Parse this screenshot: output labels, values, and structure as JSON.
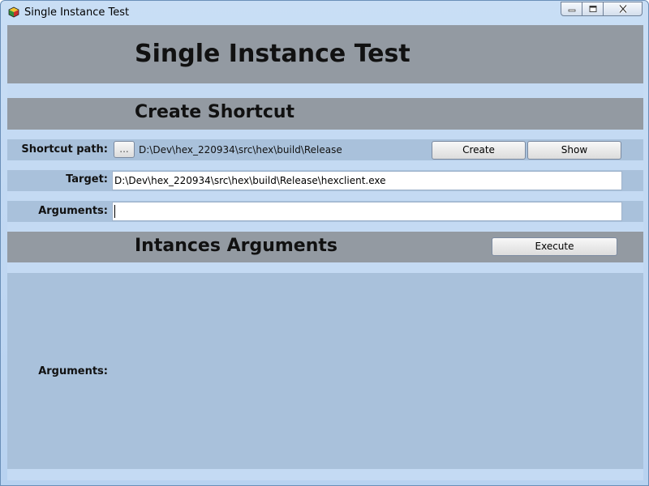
{
  "window": {
    "title": "Single Instance Test"
  },
  "header": {
    "title": "Single Instance Test"
  },
  "create_shortcut": {
    "heading": "Create Shortcut",
    "shortcut_path_label": "Shortcut path:",
    "browse_label": "...",
    "shortcut_path_value": "D:\\Dev\\hex_220934\\src\\hex\\build\\Release",
    "create_label": "Create",
    "show_label": "Show",
    "target_label": "Target:",
    "target_value": "D:\\Dev\\hex_220934\\src\\hex\\build\\Release\\hexclient.exe",
    "arguments_label": "Arguments:",
    "arguments_value": ""
  },
  "instances": {
    "heading": "Intances Arguments",
    "execute_label": "Execute",
    "arguments_label": "Arguments:"
  },
  "colors": {
    "band_dark": "#939aa2",
    "band_light": "#a9c1db",
    "window_bg": "#c4daf3",
    "close_red": "#c0392b"
  }
}
